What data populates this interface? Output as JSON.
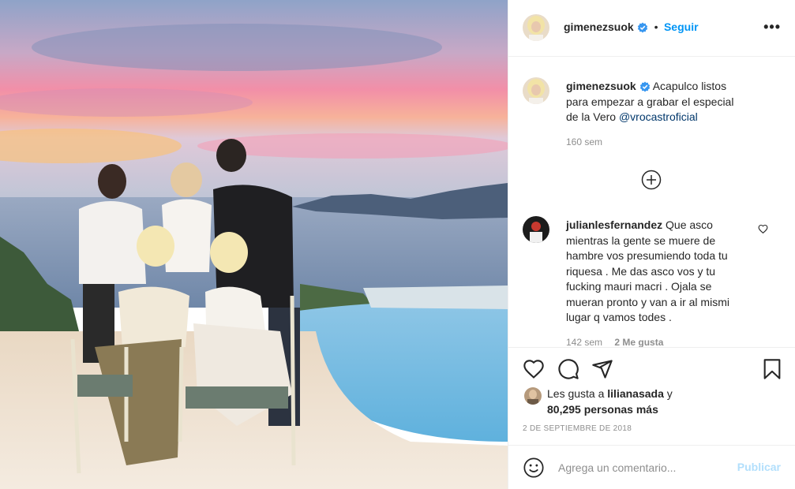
{
  "post": {
    "username": "gimenezsuok",
    "follow_label": "Seguir",
    "separator": "•",
    "more_label": "•••"
  },
  "caption": {
    "username": "gimenezsuok",
    "text": "Acapulco listos para empezar a grabar el especial de la Vero",
    "mention": "@vrocastroficial",
    "time": "160 sem"
  },
  "load_more_icon": "plus-circle-icon",
  "comments": [
    {
      "username": "julianlesfernandez",
      "text": "Que asco mientras la gente se muere de hambre vos presumiendo toda tu riquesa . Me das asco vos y tu fucking mauri macri . Ojala se mueran pronto y van a ir al mismi lugar q vamos todes .",
      "time": "142 sem",
      "likes": "2 Me gusta"
    }
  ],
  "likes": {
    "prefix": "Les gusta a",
    "user": "lilianasada",
    "conjunction": "y",
    "count": "80,295 personas más"
  },
  "date": "2 DE SEPTIEMBRE DE 2018",
  "add_comment": {
    "placeholder": "Agrega un comentario...",
    "publish_label": "Publicar"
  },
  "colors": {
    "accent": "#0095f6",
    "verified": "#3897f0",
    "publish_disabled": "#b2dffc",
    "mention": "#00376b"
  },
  "icons": [
    "emoji-icon",
    "heart-icon",
    "comment-icon",
    "share-icon",
    "bookmark-icon",
    "verified-icon",
    "more-icon"
  ]
}
